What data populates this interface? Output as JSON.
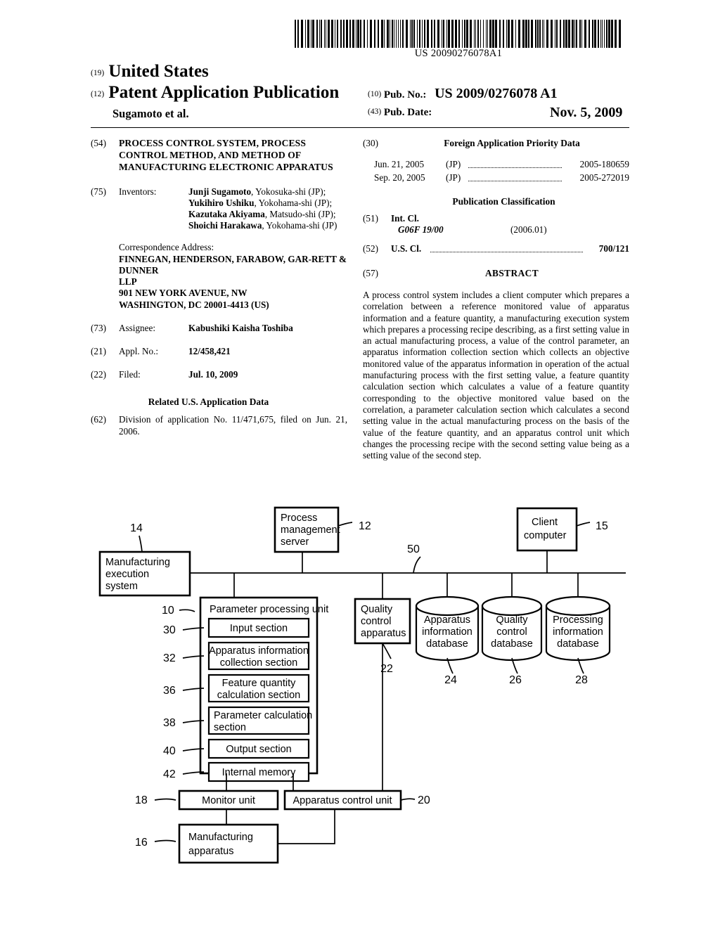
{
  "header": {
    "pub_number_barcode_text": "US 20090276078A1",
    "kind_19": "(19)",
    "country": "United States",
    "kind_12": "(12)",
    "doc_type": "Patent Application Publication",
    "authors": "Sugamoto et al.",
    "kind_10": "(10)",
    "pubno_label": "Pub. No.:",
    "pubno_value": "US 2009/0276078 A1",
    "kind_43": "(43)",
    "pubdate_label": "Pub. Date:",
    "pubdate_value": "Nov. 5, 2009"
  },
  "left": {
    "title_code": "(54)",
    "title": "PROCESS CONTROL SYSTEM, PROCESS CONTROL METHOD, AND METHOD OF MANUFACTURING ELECTRONIC APPARATUS",
    "inventors_code": "(75)",
    "inventors_label": "Inventors:",
    "inventors_html": "<b>Junji Sugamoto</b>, Yokosuka-shi (JP); <b>Yukihiro Ushiku</b>, Yokohama-shi (JP); <b>Kazutaka Akiyama</b>, Matsudo-shi (JP); <b>Shoichi Harakawa</b>, Yokohama-shi (JP)",
    "correspondence_label": "Correspondence Address:",
    "correspondence_address": "FINNEGAN, HENDERSON, FARABOW, GAR-RETT & DUNNER\nLLP\n901 NEW YORK AVENUE, NW\nWASHINGTON, DC 20001-4413 (US)",
    "assignee_code": "(73)",
    "assignee_label": "Assignee:",
    "assignee_value": "Kabushiki Kaisha Toshiba",
    "applno_code": "(21)",
    "applno_label": "Appl. No.:",
    "applno_value": "12/458,421",
    "filed_code": "(22)",
    "filed_label": "Filed:",
    "filed_value": "Jul. 10, 2009",
    "related_heading": "Related U.S. Application Data",
    "division_code": "(62)",
    "division_text": "Division of application No. 11/471,675, filed on Jun. 21, 2006."
  },
  "right": {
    "foreign_code": "(30)",
    "foreign_heading": "Foreign Application Priority Data",
    "priority": [
      {
        "date": "Jun. 21, 2005",
        "country": "(JP)",
        "number": "2005-180659"
      },
      {
        "date": "Sep. 20, 2005",
        "country": "(JP)",
        "number": "2005-272019"
      }
    ],
    "pubclass_heading": "Publication Classification",
    "intcl_code": "(51)",
    "intcl_label": "Int. Cl.",
    "intcl_symbol": "G06F  19/00",
    "intcl_version": "(2006.01)",
    "uscl_code": "(52)",
    "uscl_label": "U.S. Cl.",
    "uscl_value": "700/121",
    "abstract_code": "(57)",
    "abstract_heading": "ABSTRACT",
    "abstract_text": "A process control system includes a client computer which prepares a correlation between a reference monitored value of apparatus information and a feature quantity, a manufacturing execution system which prepares a processing recipe describing, as a first setting value in an actual manufacturing process, a value of the control parameter, an apparatus information collection section which collects an objective monitored value of the apparatus information in operation of the actual manufacturing process with the first setting value, a feature quantity calculation section which calculates a value of a feature quantity corresponding to the objective monitored value based on the correlation, a parameter calculation section which calculates a second setting value in the actual manufacturing process on the basis of the value of the feature quantity, and an apparatus control unit which changes the processing recipe with the second setting value being as a setting value of the second step."
  },
  "figure": {
    "boxes": {
      "manufacturing_execution_system": "Manufacturing execution system",
      "process_management_server": "Process management server",
      "client_computer": "Client computer",
      "parameter_processing_unit": "Parameter processing unit",
      "input_section": "Input section",
      "apparatus_information_collection_section": "Apparatus information collection section",
      "feature_quantity_calculation_section": "Feature quantity calculation section",
      "parameter_calculation_section": "Parameter calculation section",
      "output_section": "Output section",
      "internal_memory": "Internal memory",
      "quality_control_apparatus": "Quality control apparatus",
      "apparatus_information_database": "Apparatus information database",
      "quality_control_database": "Quality control database",
      "processing_information_database": "Processing information database",
      "monitor_unit": "Monitor unit",
      "apparatus_control_unit": "Apparatus control unit",
      "manufacturing_apparatus": "Manufacturing apparatus"
    },
    "ref_numbers": {
      "mes": "14",
      "pms": "12",
      "client": "15",
      "ppu": "10",
      "input": "30",
      "collection": "32",
      "feature": "36",
      "parameter": "38",
      "output": "40",
      "memory": "42",
      "bus": "50",
      "qc_apparatus": "22",
      "apparatus_db": "24",
      "qc_db": "26",
      "processing_db": "28",
      "monitor": "18",
      "control": "20",
      "manufacturing": "16"
    }
  }
}
